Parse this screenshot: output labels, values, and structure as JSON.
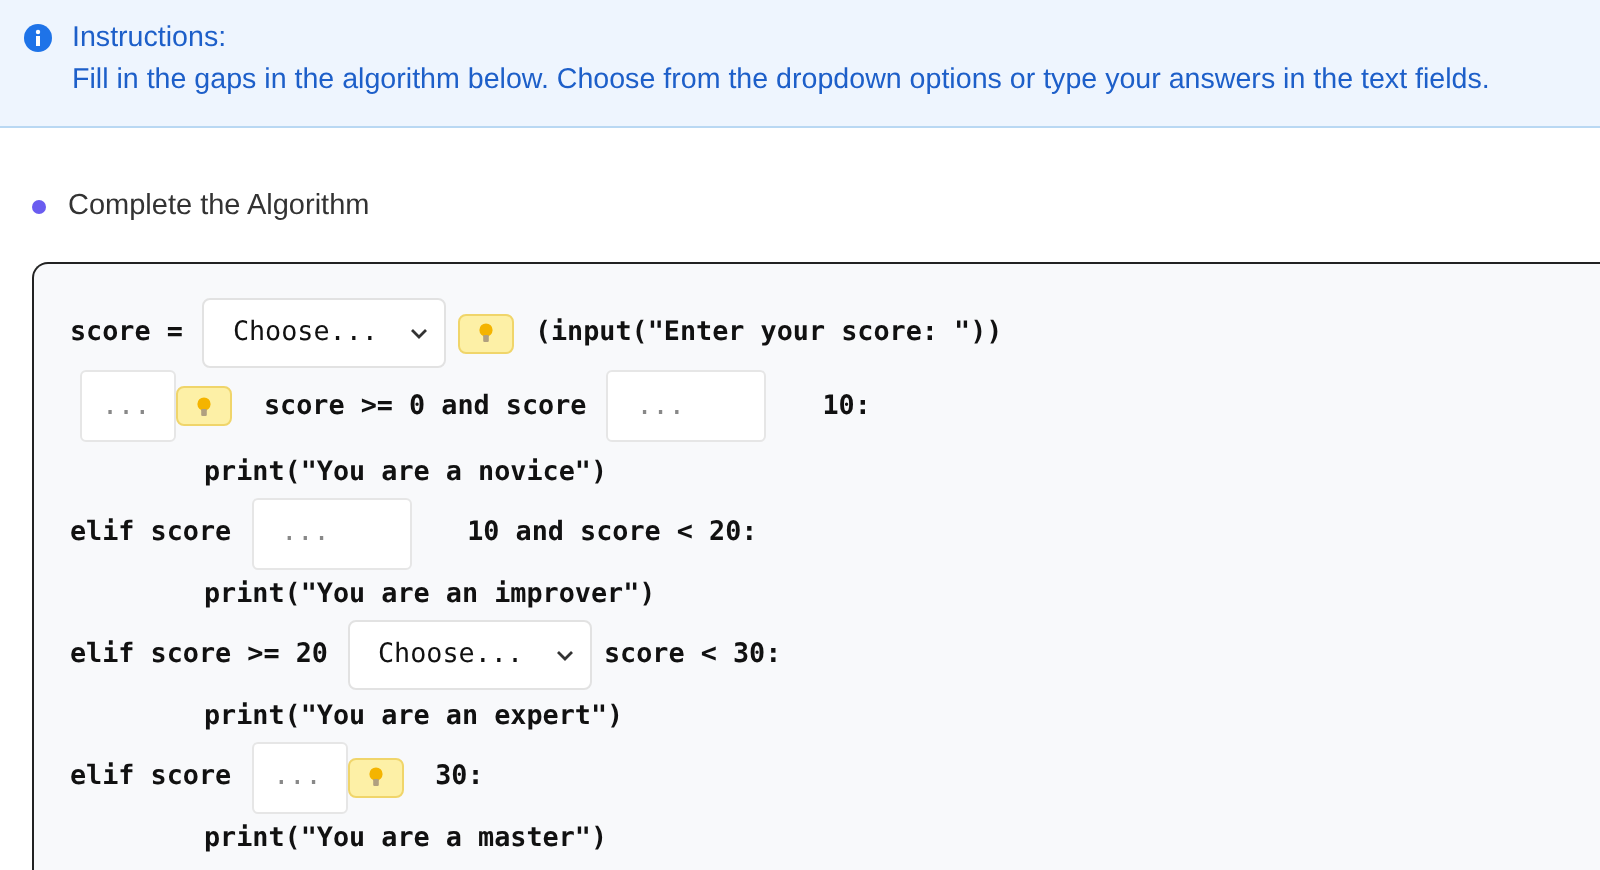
{
  "instructions": {
    "title": "Instructions:",
    "text": "Fill in the gaps in the algorithm below. Choose from the dropdown options or type your answers in the text fields."
  },
  "section": {
    "title": "Complete the Algorithm"
  },
  "lines": [
    {
      "indent": false,
      "parts": [
        {
          "kind": "text",
          "text": "score ="
        },
        {
          "kind": "select",
          "value": "Choose...",
          "hint": true
        },
        {
          "kind": "text",
          "text": "(input(\"Enter your score: \"))"
        }
      ]
    },
    {
      "indent": false,
      "parts": [
        {
          "kind": "input",
          "placeholder": "...",
          "hint": true
        },
        {
          "kind": "text",
          "text": "score >= 0 and score"
        },
        {
          "kind": "input",
          "placeholder": "...",
          "hint": false
        },
        {
          "kind": "text",
          "text": "10:"
        }
      ]
    },
    {
      "indent": true,
      "parts": [
        {
          "kind": "text",
          "text": "print(\"You are a novice\")"
        }
      ]
    },
    {
      "indent": false,
      "parts": [
        {
          "kind": "text",
          "text": "elif score"
        },
        {
          "kind": "input",
          "placeholder": "...",
          "hint": false
        },
        {
          "kind": "text",
          "text": "10 and score < 20:"
        }
      ]
    },
    {
      "indent": true,
      "parts": [
        {
          "kind": "text",
          "text": "print(\"You are an improver\")"
        }
      ]
    },
    {
      "indent": false,
      "parts": [
        {
          "kind": "text",
          "text": "elif score >= 20"
        },
        {
          "kind": "select",
          "value": "Choose...",
          "hint": false
        },
        {
          "kind": "text",
          "text": "score < 30:"
        }
      ]
    },
    {
      "indent": true,
      "parts": [
        {
          "kind": "text",
          "text": "print(\"You are an expert\")"
        }
      ]
    },
    {
      "indent": false,
      "parts": [
        {
          "kind": "text",
          "text": "elif score"
        },
        {
          "kind": "input",
          "placeholder": "...",
          "hint": true
        },
        {
          "kind": "text",
          "text": "30:"
        }
      ]
    },
    {
      "indent": true,
      "parts": [
        {
          "kind": "text",
          "text": "print(\"You are a master\")"
        }
      ]
    }
  ]
}
